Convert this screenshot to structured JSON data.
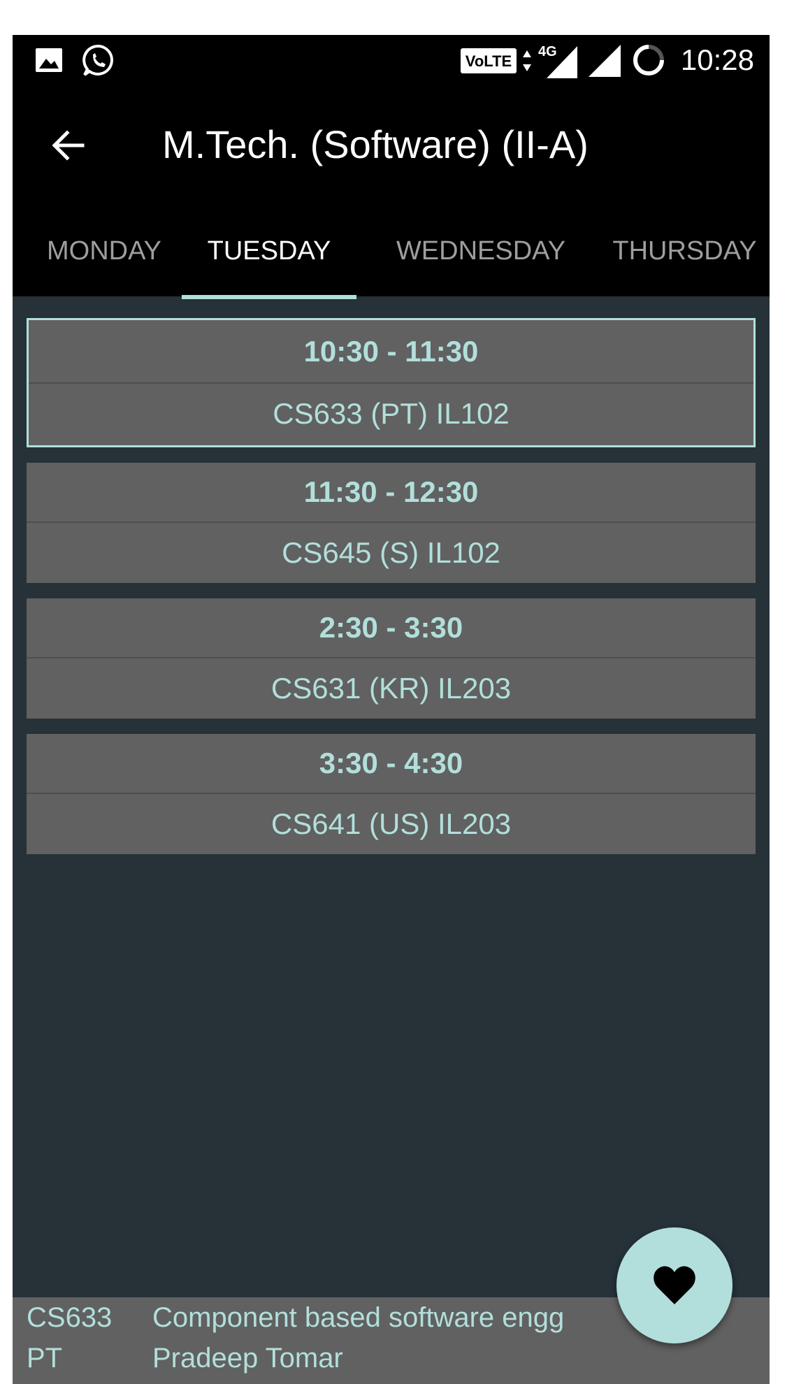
{
  "status_bar": {
    "time": "10:28",
    "icons": [
      "image-icon",
      "whatsapp-icon",
      "volte-icon",
      "data-arrows-icon",
      "signal-4g-icon",
      "signal-icon",
      "loading-icon"
    ],
    "volte_label": "VoLTE",
    "network_label": "4G"
  },
  "app_bar": {
    "title": "M.Tech. (Software) (II-A)",
    "back_icon": "arrow-back-icon"
  },
  "tabs": [
    {
      "label": "MONDAY",
      "active": false
    },
    {
      "label": "TUESDAY",
      "active": true
    },
    {
      "label": "WEDNESDAY",
      "active": false
    },
    {
      "label": "THURSDAY",
      "active": false
    }
  ],
  "slots": [
    {
      "time": "10:30 - 11:30",
      "course": "CS633 (PT) IL102",
      "selected": true
    },
    {
      "time": "11:30 - 12:30",
      "course": "CS645 (S) IL102",
      "selected": false
    },
    {
      "time": "2:30 - 3:30",
      "course": "CS631 (KR) IL203",
      "selected": false
    },
    {
      "time": "3:30 - 4:30",
      "course": "CS641 (US) IL203",
      "selected": false
    }
  ],
  "info": {
    "code": "CS633",
    "name": "Component based software engg",
    "faculty_code": "PT",
    "faculty_name": "Pradeep Tomar"
  },
  "fab": {
    "icon": "heart-icon"
  },
  "colors": {
    "accent": "#b2dfdb",
    "background": "#263238",
    "card": "#616161",
    "bar": "#000000"
  }
}
